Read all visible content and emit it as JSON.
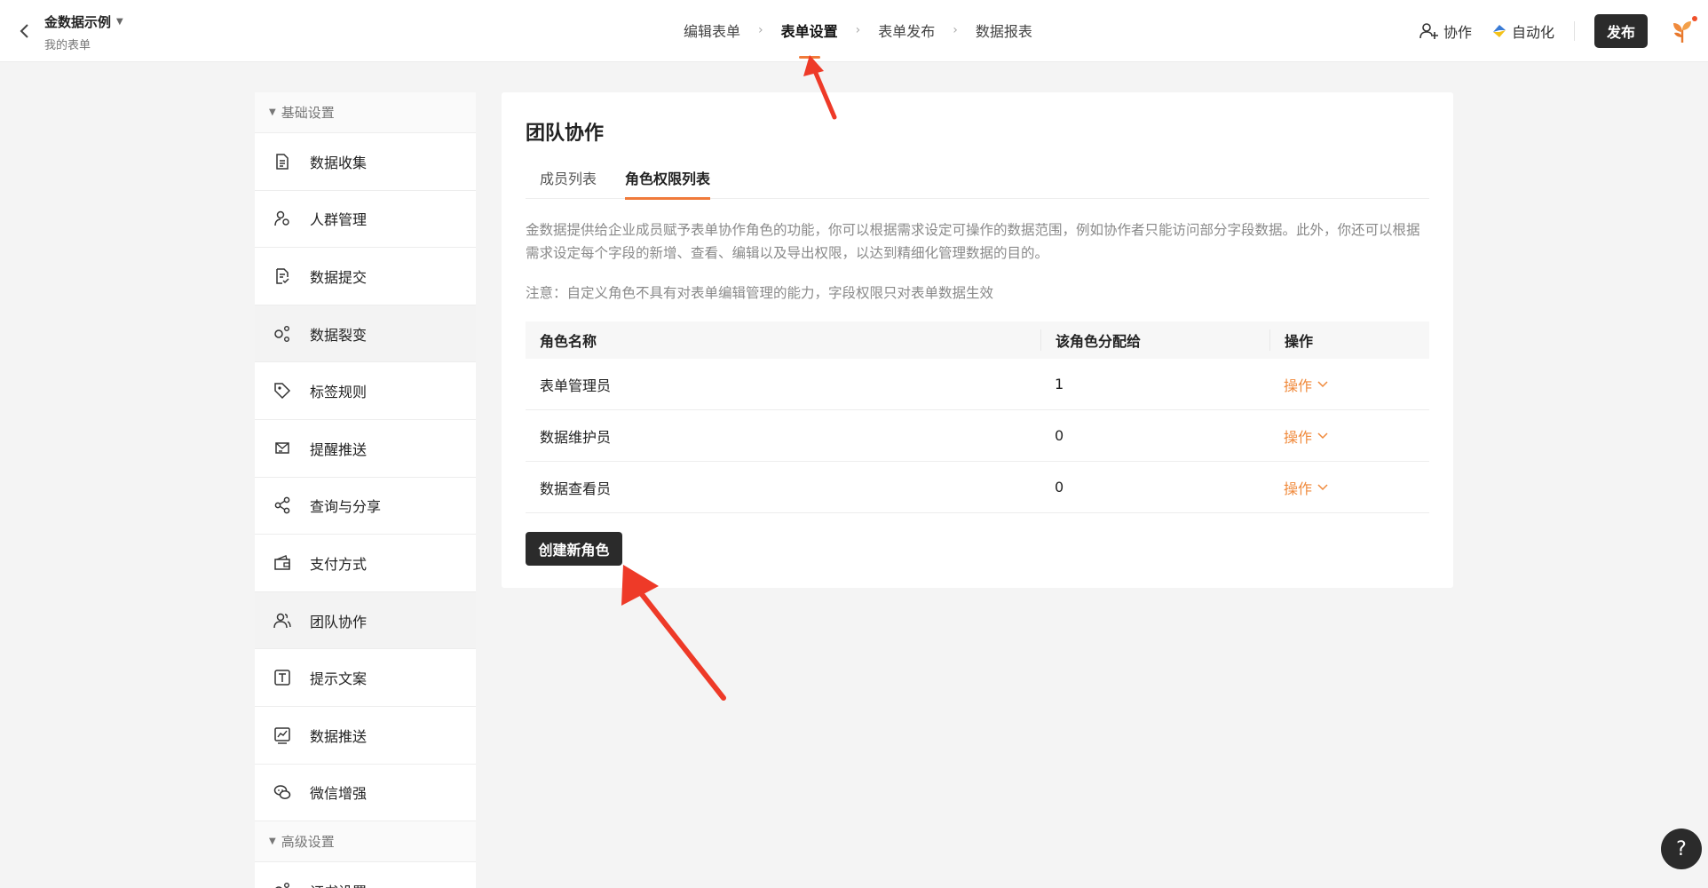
{
  "header": {
    "app_title": "金数据示例",
    "app_subtitle": "我的表单",
    "steps": [
      {
        "label": "编辑表单",
        "active": false
      },
      {
        "label": "表单设置",
        "active": true
      },
      {
        "label": "表单发布",
        "active": false
      },
      {
        "label": "数据报表",
        "active": false
      }
    ],
    "collaborate_label": "协作",
    "automation_label": "自动化",
    "publish_label": "发布"
  },
  "sidebar": {
    "basic_section": "基础设置",
    "items": [
      {
        "label": "数据收集",
        "icon": "document-icon"
      },
      {
        "label": "人群管理",
        "icon": "people-settings-icon"
      },
      {
        "label": "数据提交",
        "icon": "document-check-icon"
      },
      {
        "label": "数据裂变",
        "icon": "fission-icon"
      },
      {
        "label": "标签规则",
        "icon": "tag-icon"
      },
      {
        "label": "提醒推送",
        "icon": "notification-icon"
      },
      {
        "label": "查询与分享",
        "icon": "share-icon"
      },
      {
        "label": "支付方式",
        "icon": "wallet-icon"
      },
      {
        "label": "团队协作",
        "icon": "team-icon"
      },
      {
        "label": "提示文案",
        "icon": "text-icon"
      },
      {
        "label": "数据推送",
        "icon": "chart-push-icon"
      },
      {
        "label": "微信增强",
        "icon": "wechat-icon"
      }
    ],
    "advanced_section": "高级设置",
    "advanced_first_item": "证书设置"
  },
  "main": {
    "title": "团队协作",
    "tabs": [
      {
        "label": "成员列表",
        "active": false
      },
      {
        "label": "角色权限列表",
        "active": true
      }
    ],
    "description": "金数据提供给企业成员赋予表单协作角色的功能，你可以根据需求设定可操作的数据范围，例如协作者只能访问部分字段数据。此外，你还可以根据需求设定每个字段的新增、查看、编辑以及导出权限，以达到精细化管理数据的目的。",
    "note": "注意：自定义角色不具有对表单编辑管理的能力，字段权限只对表单数据生效",
    "table": {
      "headers": [
        "角色名称",
        "该角色分配给",
        "操作"
      ],
      "rows": [
        {
          "name": "表单管理员",
          "count": "1",
          "action": "操作"
        },
        {
          "name": "数据维护员",
          "count": "0",
          "action": "操作"
        },
        {
          "name": "数据查看员",
          "count": "0",
          "action": "操作"
        }
      ]
    },
    "create_button": "创建新角色"
  },
  "help_label": "?",
  "colors": {
    "accent": "#f07a3a",
    "dark_button": "#2b2b2b",
    "annotation_arrow": "#ee3a28"
  }
}
